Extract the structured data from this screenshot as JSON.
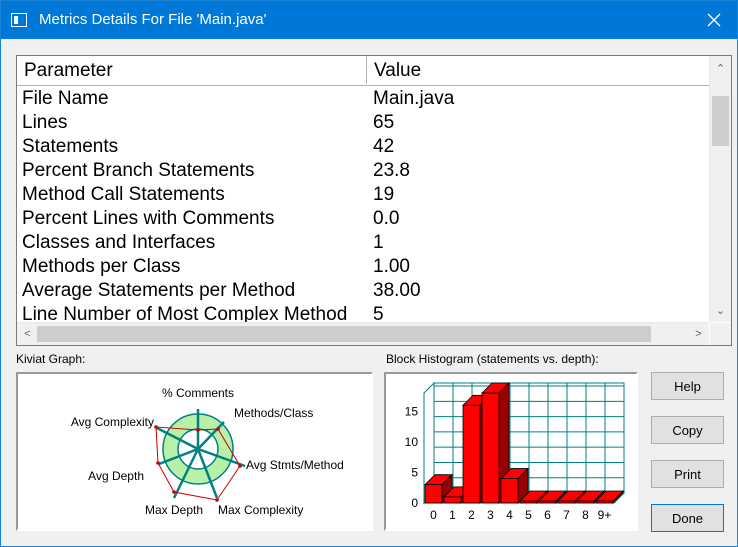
{
  "window": {
    "title": "Metrics Details For File 'Main.java'"
  },
  "table": {
    "columns": [
      "Parameter",
      "Value"
    ],
    "rows": [
      [
        "File Name",
        "Main.java"
      ],
      [
        "Lines",
        "65"
      ],
      [
        "Statements",
        "42"
      ],
      [
        "Percent Branch Statements",
        "23.8"
      ],
      [
        "Method Call Statements",
        "19"
      ],
      [
        "Percent Lines with Comments",
        "0.0"
      ],
      [
        "Classes and Interfaces",
        "1"
      ],
      [
        "Methods per Class",
        "1.00"
      ],
      [
        "Average Statements per Method",
        "38.00"
      ],
      [
        "Line Number of Most Complex Method",
        "5"
      ]
    ]
  },
  "kiviat": {
    "label": "Kiviat Graph:",
    "axes": [
      "% Comments",
      "Methods/Class",
      "Avg Stmts/Method",
      "Max Complexity",
      "Max Depth",
      "Avg Depth",
      "Avg Complexity"
    ],
    "colors": {
      "ring_fill": "#b8f0a8",
      "ring_stroke": "#008080",
      "plot_line": "#cc0000"
    }
  },
  "histogram": {
    "label": "Block Histogram (statements vs. depth):",
    "chart_data": {
      "type": "bar",
      "categories": [
        "0",
        "1",
        "2",
        "3",
        "4",
        "5",
        "6",
        "7",
        "8",
        "9+"
      ],
      "values": [
        3,
        1,
        16,
        18,
        4,
        0,
        0,
        0,
        0,
        0
      ],
      "xlabel": "",
      "ylabel": "",
      "ylim": [
        0,
        18
      ],
      "yticks": [
        0,
        5,
        10,
        15
      ],
      "grid": true,
      "colors": {
        "bar": "#ff0000",
        "bar_dark": "#990000",
        "grid": "#008080"
      }
    }
  },
  "buttons": {
    "help": "Help",
    "copy": "Copy",
    "print": "Print",
    "done": "Done"
  }
}
